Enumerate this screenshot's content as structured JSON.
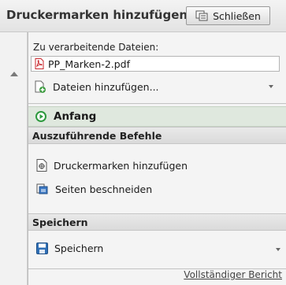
{
  "window": {
    "title": "Druckermarken hinzufügen",
    "close_label": "Schließen"
  },
  "files": {
    "label": "Zu verarbeitende Dateien:",
    "items": [
      "PP_Marken-2.pdf"
    ],
    "add_label": "Dateien hinzufügen..."
  },
  "start": {
    "label": "Anfang"
  },
  "sections": [
    {
      "title": "Auszuführende Befehle",
      "commands": [
        "Druckermarken hinzufügen",
        "Seiten beschneiden"
      ]
    },
    {
      "title": "Speichern",
      "commands": [
        "Speichern"
      ]
    }
  ],
  "footer": {
    "report_link": "Vollständiger Bericht"
  },
  "colors": {
    "start_bg": "#dfe8de",
    "start_icon": "#2e9a3f",
    "pdf_icon": "#c8262b"
  }
}
